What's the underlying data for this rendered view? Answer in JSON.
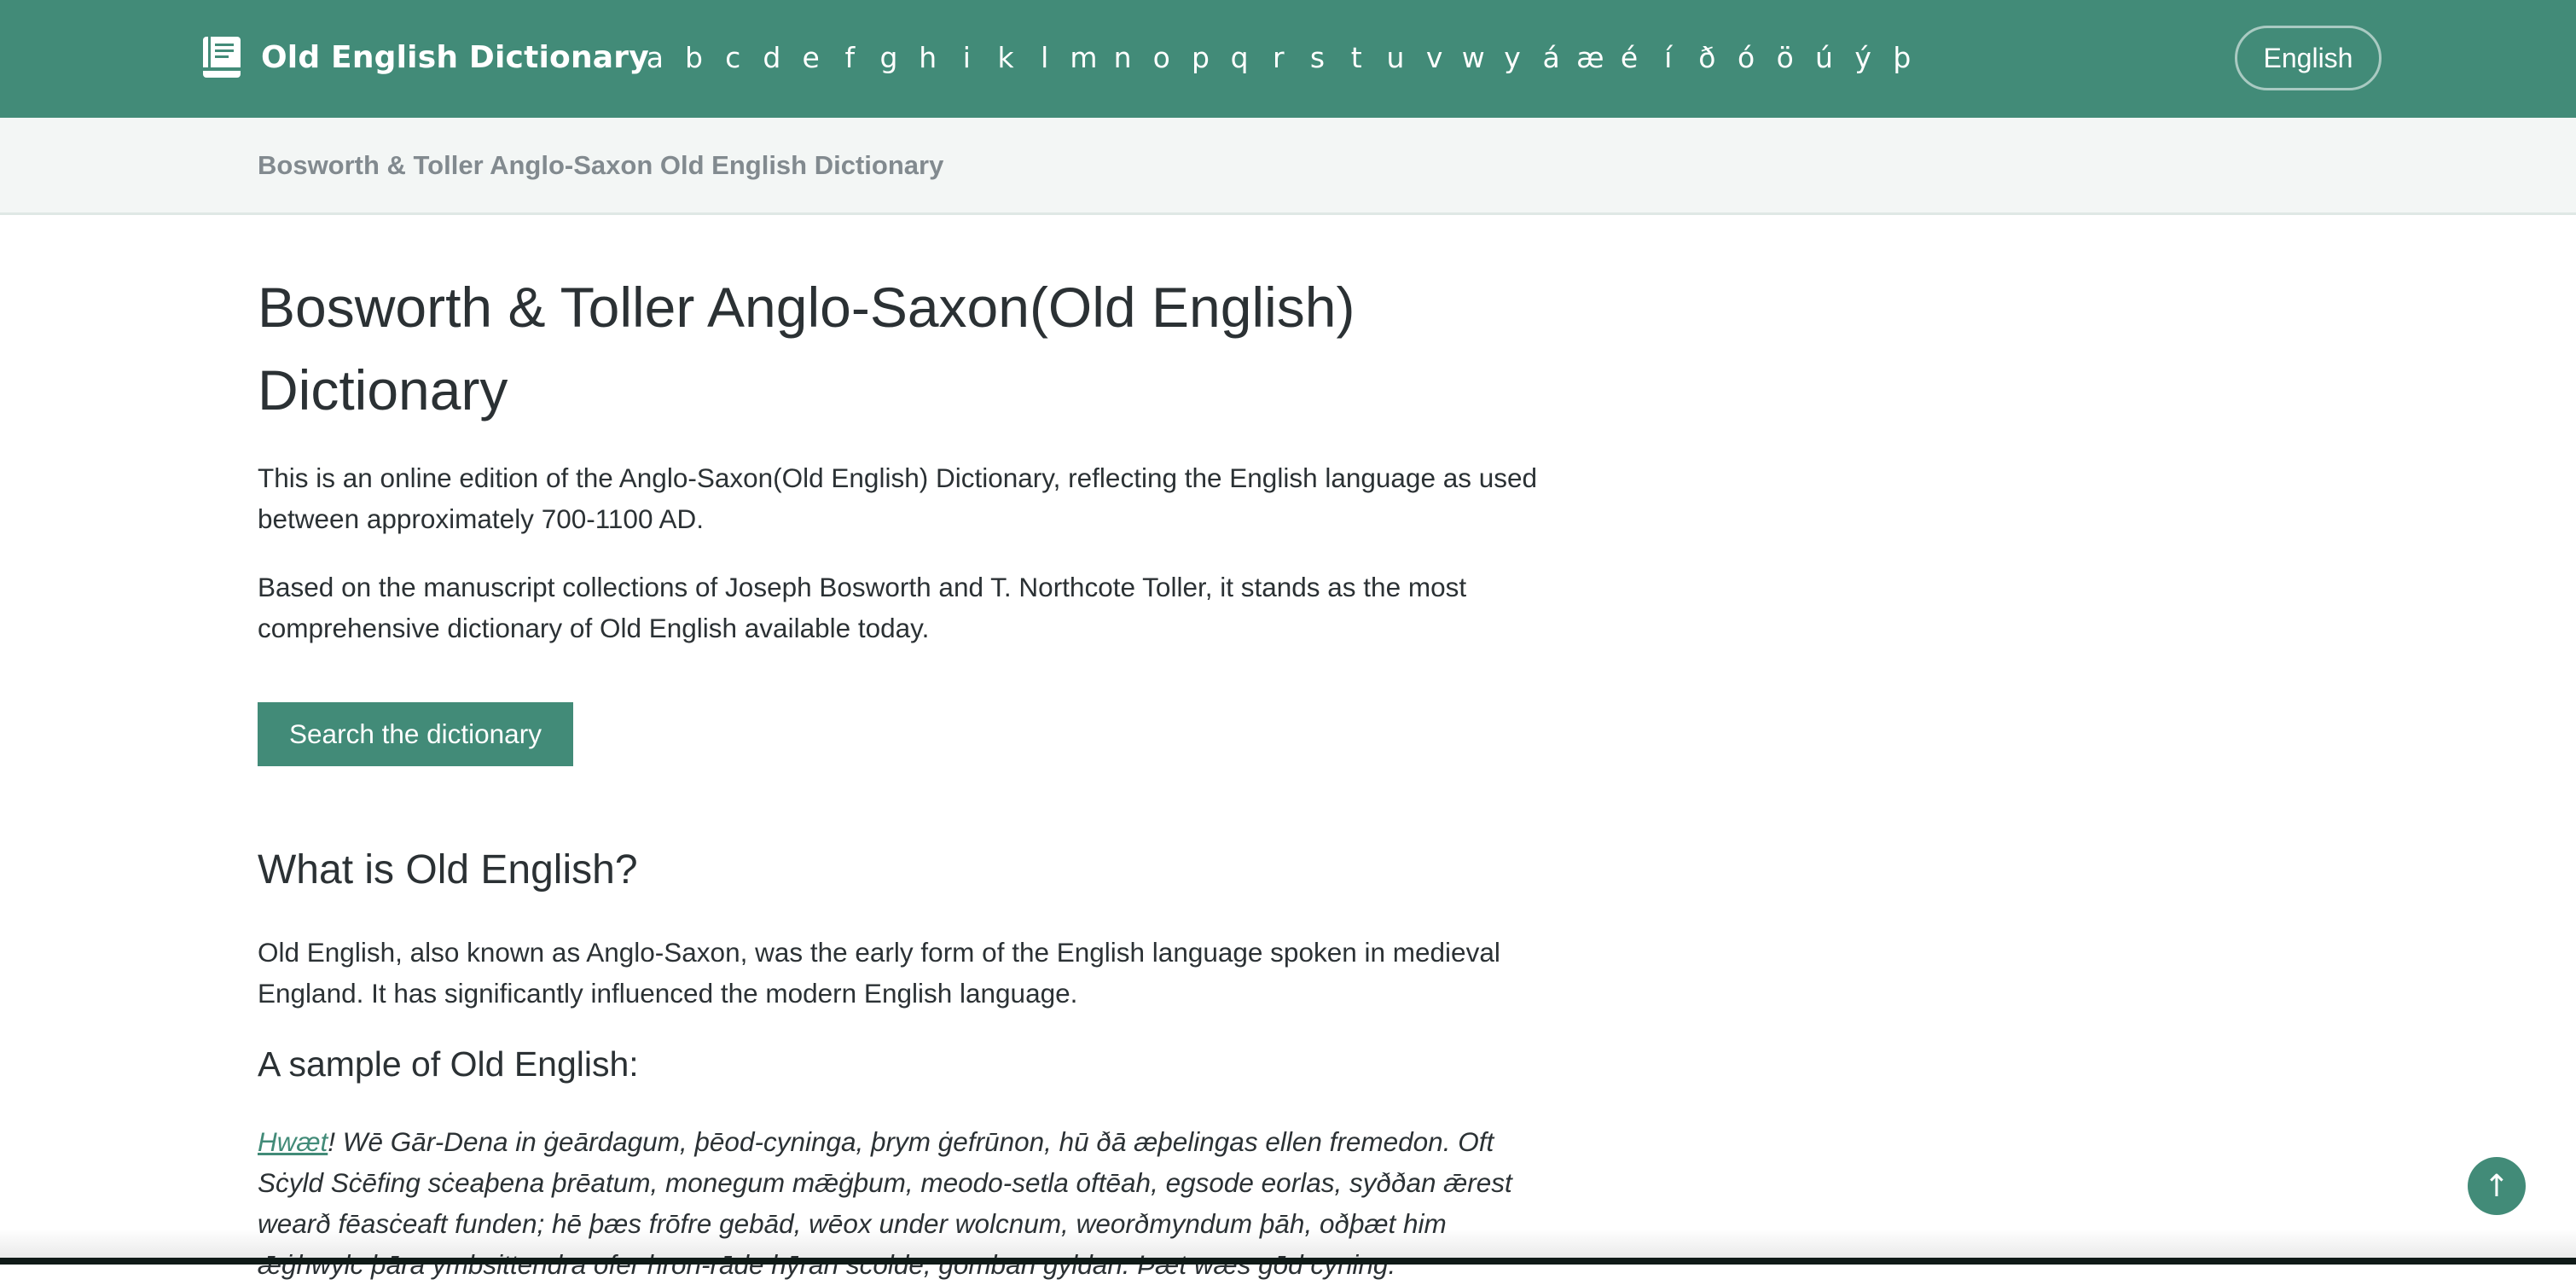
{
  "header": {
    "brand_title": "Old English Dictionary",
    "brand_icon": "book-icon",
    "alphabet": [
      "a",
      "b",
      "c",
      "d",
      "e",
      "f",
      "g",
      "h",
      "i",
      "k",
      "l",
      "m",
      "n",
      "o",
      "p",
      "q",
      "r",
      "s",
      "t",
      "u",
      "v",
      "w",
      "y",
      "á",
      "æ",
      "é",
      "í",
      "ð",
      "ó",
      "ö",
      "ú",
      "ý",
      "þ"
    ],
    "language_label": "English",
    "background_color": "#428b78"
  },
  "breadcrumb": {
    "label": "Bosworth & Toller Anglo-Saxon Old English Dictionary"
  },
  "main": {
    "title": "Bosworth & Toller Anglo-Saxon(Old English) Dictionary",
    "intro_1": "This is an online edition of the Anglo-Saxon(Old English) Dictionary, reflecting the English language as used between approximately 700-1100 AD.",
    "intro_2": "Based on the manuscript collections of Joseph Bosworth and T. Northcote Toller, it stands as the most comprehensive dictionary of Old English available today.",
    "search_button_label": "Search the dictionary",
    "what_heading": "What is Old English?",
    "what_text": "Old English, also known as Anglo-Saxon, was the early form of the English language spoken in medieval England. It has significantly influenced the modern English language.",
    "sample_heading": "A sample of Old English:",
    "sample_link": "Hwæt",
    "sample_text": "! Wē Gār-Dena in ġeārdagum, þēod-cyninga, þrym ġefrūnon, hū ðā æþelingas ellen fremedon. Oft Sċyld Sċēfing sċeaþena þrēatum, monegum mǣġþum, meodo-setla oftēah, egsode eorlas, syððan ǣrest wearð fēasċeaft funden; hē þæs frōfre gebād, wēox under wolcnum, weorðmyndum þāh, oðþæt him ǣġhwylc þāra ymbsittendra ofer hron-rāde hȳran scolde, gomban gyldan. Þæt wæs gōd cyning."
  },
  "back_to_top": {
    "icon": "arrow-up-icon",
    "glyph": "↑"
  },
  "colors": {
    "accent": "#428b78",
    "text": "#2b3134",
    "muted": "#828a8f"
  }
}
